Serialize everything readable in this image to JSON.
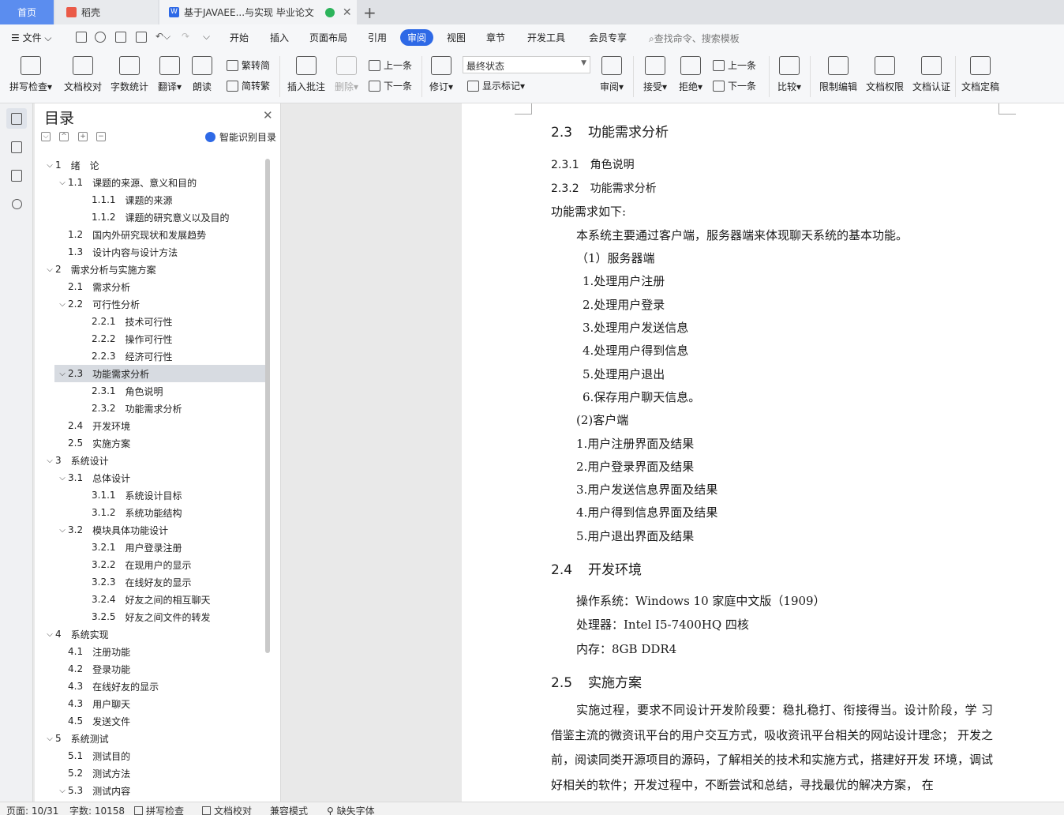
{
  "tabs": {
    "home": "首页",
    "daoke": "稻壳",
    "doc": "基于JAVAEE...与实现 毕业论文",
    "add": "+"
  },
  "menu": {
    "file": "文件",
    "items": [
      "开始",
      "插入",
      "页面布局",
      "引用",
      "审阅",
      "视图",
      "章节",
      "开发工具",
      "会员专享"
    ],
    "active": "审阅",
    "search_placeholder": "查找命令、搜索模板"
  },
  "ribbon": {
    "spell": "拼写检查",
    "doc_proof": "文档校对",
    "word_count": "字数统计",
    "translate": "翻译",
    "read_aloud": "朗读",
    "to_traditional": "繁转简",
    "to_simplified": "简转繁",
    "insert_comment": "插入批注",
    "delete": "删除",
    "prev": "上一条",
    "next": "下一条",
    "track": "修订",
    "markup_state": "最终状态",
    "show_markup": "显示标记",
    "review": "审阅",
    "accept": "接受",
    "reject": "拒绝",
    "prev2": "上一条",
    "next2": "下一条",
    "compare": "比较",
    "restrict_edit": "限制编辑",
    "doc_rights": "文档权限",
    "doc_cert": "文档认证",
    "finalize": "文档定稿"
  },
  "toc": {
    "title": "目录",
    "ai_label": "智能识别目录",
    "items": [
      {
        "level": 1,
        "num": "1",
        "text": "绪　论",
        "chev": "v"
      },
      {
        "level": 2,
        "num": "1.1",
        "text": "课题的来源、意义和目的",
        "chev": "v"
      },
      {
        "level": 3,
        "num": "1.1.1",
        "text": "课题的来源",
        "chev": ""
      },
      {
        "level": 3,
        "num": "1.1.2",
        "text": "课题的研究意义以及目的",
        "chev": ""
      },
      {
        "level": 2,
        "num": "1.2",
        "text": "国内外研究现状和发展趋势",
        "chev": ""
      },
      {
        "level": 2,
        "num": "1.3",
        "text": "设计内容与设计方法",
        "chev": ""
      },
      {
        "level": 1,
        "num": "2",
        "text": "需求分析与实施方案",
        "chev": "v"
      },
      {
        "level": 2,
        "num": "2.1",
        "text": "需求分析",
        "chev": ""
      },
      {
        "level": 2,
        "num": "2.2",
        "text": "可行性分析",
        "chev": "v"
      },
      {
        "level": 3,
        "num": "2.2.1",
        "text": "技术可行性",
        "chev": ""
      },
      {
        "level": 3,
        "num": "2.2.2",
        "text": "操作可行性",
        "chev": ""
      },
      {
        "level": 3,
        "num": "2.2.3",
        "text": "经济可行性",
        "chev": ""
      },
      {
        "level": 2,
        "num": "2.3",
        "text": "功能需求分析",
        "chev": "v",
        "selected": true
      },
      {
        "level": 3,
        "num": "2.3.1",
        "text": "角色说明",
        "chev": ""
      },
      {
        "level": 3,
        "num": "2.3.2",
        "text": "功能需求分析",
        "chev": ""
      },
      {
        "level": 2,
        "num": "2.4",
        "text": "开发环境",
        "chev": ""
      },
      {
        "level": 2,
        "num": "2.5",
        "text": "实施方案",
        "chev": ""
      },
      {
        "level": 1,
        "num": "3",
        "text": "系统设计",
        "chev": "v"
      },
      {
        "level": 2,
        "num": "3.1",
        "text": "总体设计",
        "chev": "v"
      },
      {
        "level": 3,
        "num": "3.1.1",
        "text": "系统设计目标",
        "chev": ""
      },
      {
        "level": 3,
        "num": "3.1.2",
        "text": "系统功能结构",
        "chev": ""
      },
      {
        "level": 2,
        "num": "3.2",
        "text": "模块具体功能设计",
        "chev": "v"
      },
      {
        "level": 3,
        "num": "3.2.1",
        "text": "用户登录注册",
        "chev": ""
      },
      {
        "level": 3,
        "num": "3.2.2",
        "text": "在现用户的显示",
        "chev": ""
      },
      {
        "level": 3,
        "num": "3.2.3",
        "text": "在线好友的显示",
        "chev": ""
      },
      {
        "level": 3,
        "num": "3.2.4",
        "text": "好友之间的相互聊天",
        "chev": ""
      },
      {
        "level": 3,
        "num": "3.2.5",
        "text": "好友之间文件的转发",
        "chev": ""
      },
      {
        "level": 1,
        "num": "4",
        "text": "系统实现",
        "chev": "v"
      },
      {
        "level": 2,
        "num": "4.1",
        "text": "注册功能",
        "chev": ""
      },
      {
        "level": 2,
        "num": "4.2",
        "text": "登录功能",
        "chev": ""
      },
      {
        "level": 2,
        "num": "4.3",
        "text": "在线好友的显示",
        "chev": ""
      },
      {
        "level": 2,
        "num": "4.3",
        "text": "用户聊天",
        "chev": ""
      },
      {
        "level": 2,
        "num": "4.5",
        "text": "发送文件",
        "chev": ""
      },
      {
        "level": 1,
        "num": "5",
        "text": "系统测试",
        "chev": "v"
      },
      {
        "level": 2,
        "num": "5.1",
        "text": "测试目的",
        "chev": ""
      },
      {
        "level": 2,
        "num": "5.2",
        "text": "测试方法",
        "chev": ""
      },
      {
        "level": 2,
        "num": "5.3",
        "text": "测试内容",
        "chev": "v"
      }
    ]
  },
  "document": {
    "h_2_3": {
      "num": "2.3",
      "text": "功能需求分析"
    },
    "h_2_3_1": {
      "num": "2.3.1",
      "text": "角色说明"
    },
    "h_2_3_2": {
      "num": "2.3.2",
      "text": "功能需求分析"
    },
    "intro": "功能需求如下:",
    "summary": "本系统主要通过客户端，服务器端来体现聊天系统的基本功能。",
    "server_head": "（1）服务器端",
    "server_items": [
      "1.处理用户注册",
      "2.处理用户登录",
      "3.处理用户发送信息",
      "4.处理用户得到信息",
      "5.处理用户退出",
      "6.保存用户聊天信息。"
    ],
    "client_head": "(2)客户端",
    "client_items": [
      "1.用户注册界面及结果",
      "2.用户登录界面及结果",
      "3.用户发送信息界面及结果",
      "4.用户得到信息界面及结果",
      "5.用户退出界面及结果"
    ],
    "h_2_4": {
      "num": "2.4",
      "text": "开发环境"
    },
    "env": [
      "操作系统：Windows 10  家庭中文版（1909）",
      "处理器：Intel I5-7400HQ  四核",
      "内存：8GB DDR4"
    ],
    "h_2_5": {
      "num": "2.5",
      "text": "实施方案"
    },
    "plan": "实施过程，要求不同设计开发阶段要：稳扎稳打、衔接得当。设计阶段，学 习借鉴主流的微资讯平台的用户交互方式，吸收资讯平台相关的网站设计理念； 开发之前，阅读同类开源项目的源码，了解相关的技术和实施方式，搭建好开发 环境，调试好相关的软件；开发过程中，不断尝试和总结，寻找最优的解决方案， 在"
  },
  "status": {
    "page": "页面: 10/31",
    "words": "字数: 10158",
    "spell": "拼写检查",
    "proof": "文档校对",
    "compat": "兼容模式",
    "missing_font": "缺失字体"
  },
  "colors": {
    "accent": "#2e69e6",
    "tab_home": "#5b8def",
    "selected_row": "#d7dbe1"
  }
}
